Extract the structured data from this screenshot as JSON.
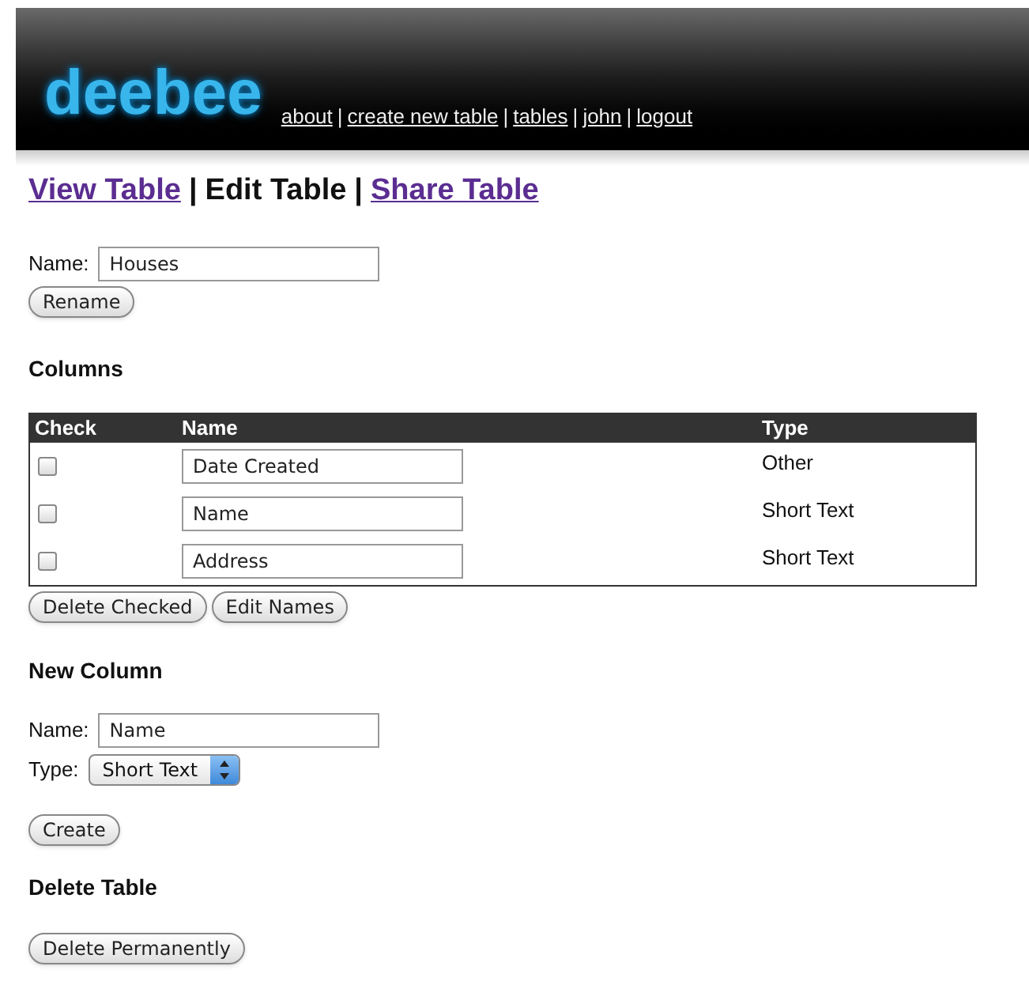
{
  "header": {
    "logo": "deebee",
    "nav": [
      {
        "kind": "link",
        "text": "about"
      },
      {
        "kind": "sep",
        "text": "|"
      },
      {
        "kind": "link",
        "text": "create new table"
      },
      {
        "kind": "sep",
        "text": "|"
      },
      {
        "kind": "link",
        "text": "tables"
      },
      {
        "kind": "sep",
        "text": "|"
      },
      {
        "kind": "link",
        "text": "john"
      },
      {
        "kind": "sep",
        "text": "|"
      },
      {
        "kind": "link",
        "text": "logout"
      }
    ]
  },
  "tabs": [
    {
      "kind": "tab",
      "text": "View Table",
      "selected": false
    },
    {
      "kind": "sep",
      "text": "|"
    },
    {
      "kind": "tab",
      "text": "Edit Table",
      "selected": true
    },
    {
      "kind": "sep",
      "text": "|"
    },
    {
      "kind": "tab",
      "text": "Share Table",
      "selected": false
    }
  ],
  "rename": {
    "label": "Name:",
    "value": "Houses",
    "button": "Rename"
  },
  "columns": {
    "heading": "Columns",
    "headers": [
      "Check",
      "Name",
      "Type"
    ],
    "rows": [
      {
        "checked": false,
        "name": "Date Created",
        "type": "Other"
      },
      {
        "checked": false,
        "name": "Name",
        "type": "Short Text"
      },
      {
        "checked": false,
        "name": "Address",
        "type": "Short Text"
      }
    ],
    "buttons": [
      "Delete Checked",
      "Edit Names"
    ]
  },
  "new_column": {
    "heading": "New Column",
    "name_label": "Name:",
    "name_value": "Name",
    "type_label": "Type:",
    "type_value": "Short Text",
    "button": "Create"
  },
  "delete_table": {
    "heading": "Delete Table",
    "button": "Delete Permanently"
  }
}
